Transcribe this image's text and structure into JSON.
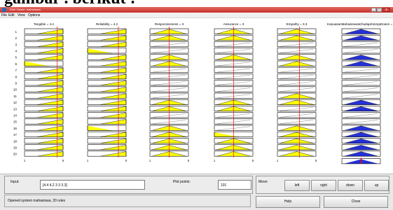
{
  "caption_fragment": "gambar . berikut :",
  "window": {
    "title": "Rule Viewer: mahasiswa",
    "controls": [
      "_",
      "□",
      "x"
    ]
  },
  "menu": [
    "File",
    "Edit",
    "View",
    "Options"
  ],
  "inputs": [
    {
      "title": "Tangible = 4.4",
      "value": 4.4
    },
    {
      "title": "Reliability = 4.2",
      "value": 4.2
    },
    {
      "title": "Responsiveness = 3",
      "value": 3
    },
    {
      "title": "Assurance = 3",
      "value": 3
    },
    {
      "title": "Empathy = 3.3",
      "value": 3.3
    }
  ],
  "output": {
    "title": "KepuasanMahasiswaterhadapKinerjaDosen = 3"
  },
  "axis": {
    "min_label": "1",
    "max_label": "5"
  },
  "rules": [
    "1",
    "2",
    "3",
    "4",
    "5",
    "6",
    "7",
    "8",
    "9",
    "10",
    "11",
    "12",
    "13",
    "14",
    "15",
    "16",
    "17",
    "18",
    "19",
    "20"
  ],
  "bottom": {
    "input_label": "Input:",
    "input_value": "[4.4 4.2 3 3 3.3]",
    "plot_points_label": "Plot points:",
    "plot_points_value": "101",
    "move_label": "Move:",
    "move_buttons": [
      "left",
      "right",
      "down",
      "up"
    ],
    "status": "Opened system mahasiswa, 20 rules",
    "help": "Help",
    "close": "Close"
  },
  "colors": {
    "fill": "#ffff00",
    "output_fill": "#2430d8",
    "line": "#ff0000",
    "bar": "#7a0000"
  }
}
